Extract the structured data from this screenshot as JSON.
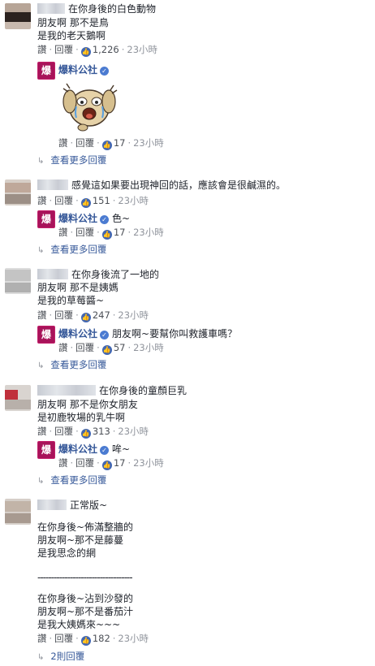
{
  "actions": {
    "like": "讚",
    "reply": "回覆",
    "sep": "·"
  },
  "page": {
    "name": "爆料公社",
    "avatar_char": "爆"
  },
  "more_replies": "查看更多回覆",
  "comments": [
    {
      "lines": [
        "在你身後的白色動物",
        "朋友啊 那不是鳥",
        "是我的老天鵝啊"
      ],
      "likes": "1,226",
      "time": "23小時",
      "reply": {
        "sticker": true,
        "likes": "17",
        "time": "23小時"
      }
    },
    {
      "lines": [
        "感覺這如果要出現神回的話，應該會是很鹹濕的。"
      ],
      "likes": "151",
      "time": "23小時",
      "reply": {
        "text": "色~",
        "likes": "17",
        "time": "23小時"
      }
    },
    {
      "lines": [
        "在你身後流了一地的",
        "朋友啊 那不是姨媽",
        "是我的草莓醬~"
      ],
      "likes": "247",
      "time": "23小時",
      "reply": {
        "text": "朋友啊~要幫你叫救護車嗎？",
        "likes": "57",
        "time": "23小時"
      }
    },
    {
      "lines": [
        "在你身後的童顏巨乳",
        "朋友啊 那不是你女朋友",
        "是初鹿牧場的乳牛啊"
      ],
      "likes": "313",
      "time": "23小時",
      "reply": {
        "text": "哞~",
        "likes": "17",
        "time": "23小時"
      }
    },
    {
      "lines": [
        "正常版~",
        "在你身後~佈滿整牆的",
        "朋友啊~那不是藤蔓",
        "是我思念的網",
        "-----------------------------------",
        "在你身後~沾到沙發的",
        "朋友啊~那不是番茄汁",
        "是我大姨媽來~~~"
      ],
      "likes": "182",
      "time": "23小時",
      "replies_link": "2則回覆"
    }
  ]
}
